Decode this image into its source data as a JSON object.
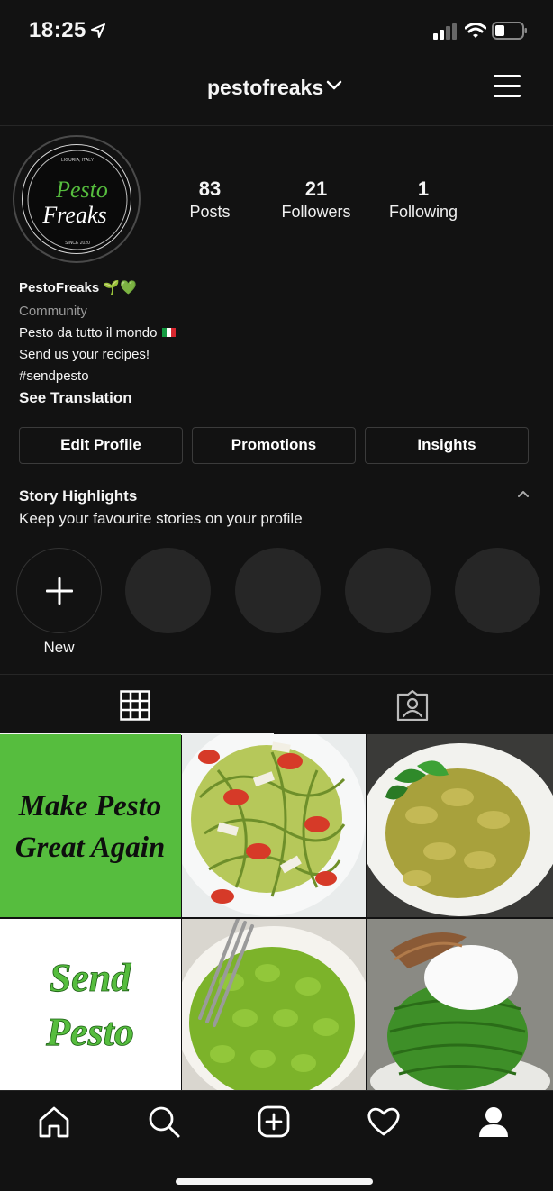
{
  "status": {
    "time": "18:25"
  },
  "header": {
    "username": "pestofreaks"
  },
  "avatar": {
    "line1": "Pesto",
    "line2": "Freaks",
    "top_text": "LIGURIA, ITALY",
    "bottom_text": "SINCE 2020"
  },
  "stats": [
    {
      "value": "83",
      "label": "Posts"
    },
    {
      "value": "21",
      "label": "Followers"
    },
    {
      "value": "1",
      "label": "Following"
    }
  ],
  "bio": {
    "name": "PestoFreaks 🌱💚",
    "category": "Community",
    "line1": "Pesto da tutto il mondo",
    "line2": "Send us your recipes!",
    "line3": "#sendpesto",
    "translate": "See Translation"
  },
  "buttons": {
    "edit": "Edit Profile",
    "promotions": "Promotions",
    "insights": "Insights"
  },
  "highlights": {
    "title": "Story Highlights",
    "subtitle": "Keep your favourite stories on your profile",
    "new_label": "New"
  },
  "posts": [
    {
      "line1": "Make Pesto",
      "line2": "Great Again"
    },
    {
      "line1": "Send",
      "line2": "Pesto"
    }
  ],
  "colors": {
    "bg": "#121212",
    "accent_green": "#56bd3e",
    "border": "#3b3b3b"
  }
}
